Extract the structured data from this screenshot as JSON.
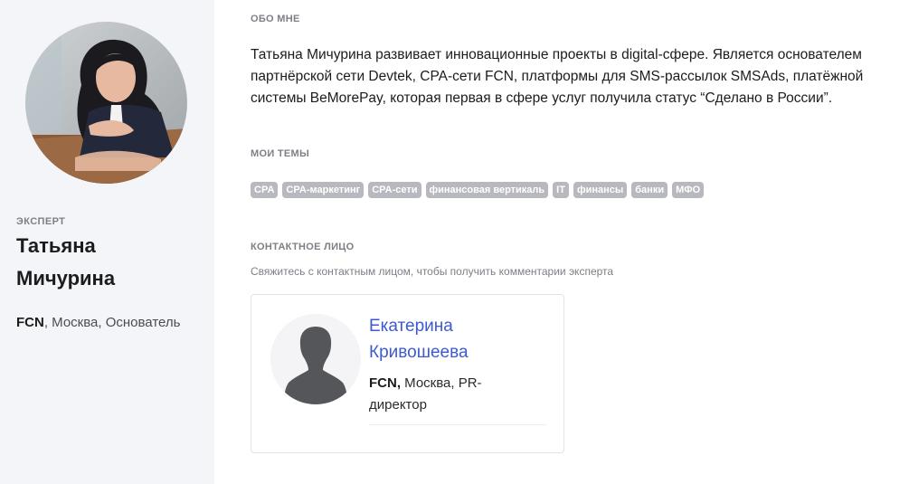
{
  "expert": {
    "label": "ЭКСПЕРТ",
    "name": "Татьяна Мичурина",
    "company": "FCN",
    "details": ", Москва, Основатель"
  },
  "about": {
    "title": "ОБО МНЕ",
    "text": "Татьяна Мичурина развивает инновационные проекты в digital-сфере. Является основателем партнёрской сети Devtek, CPA-сети FCN, платформы для SMS-рассылок SMSAds, платёжной системы BeMorePay, которая первая в сфере услуг получила статус “Сделано в России”."
  },
  "topics": {
    "title": "МОИ ТЕМЫ",
    "tags": [
      "CPA",
      "CPA-маркетинг",
      "CPA-сети",
      "финансовая вертикаль",
      "IT",
      "финансы",
      "банки",
      "МФО"
    ]
  },
  "contact": {
    "title": "КОНТАКТНОЕ ЛИЦО",
    "hint": "Свяжитесь с контактным лицом, чтобы получить комментарии эксперта",
    "name": "Екатерина Кривошеева",
    "company": "FCN,",
    "details": " Москва, PR-директор"
  },
  "icons": {
    "contact_avatar": "person-silhouette-icon"
  },
  "colors": {
    "sidebar_bg": "#f4f5f9",
    "tag_bg": "#b7b9bf",
    "link": "#3d5ad1"
  }
}
